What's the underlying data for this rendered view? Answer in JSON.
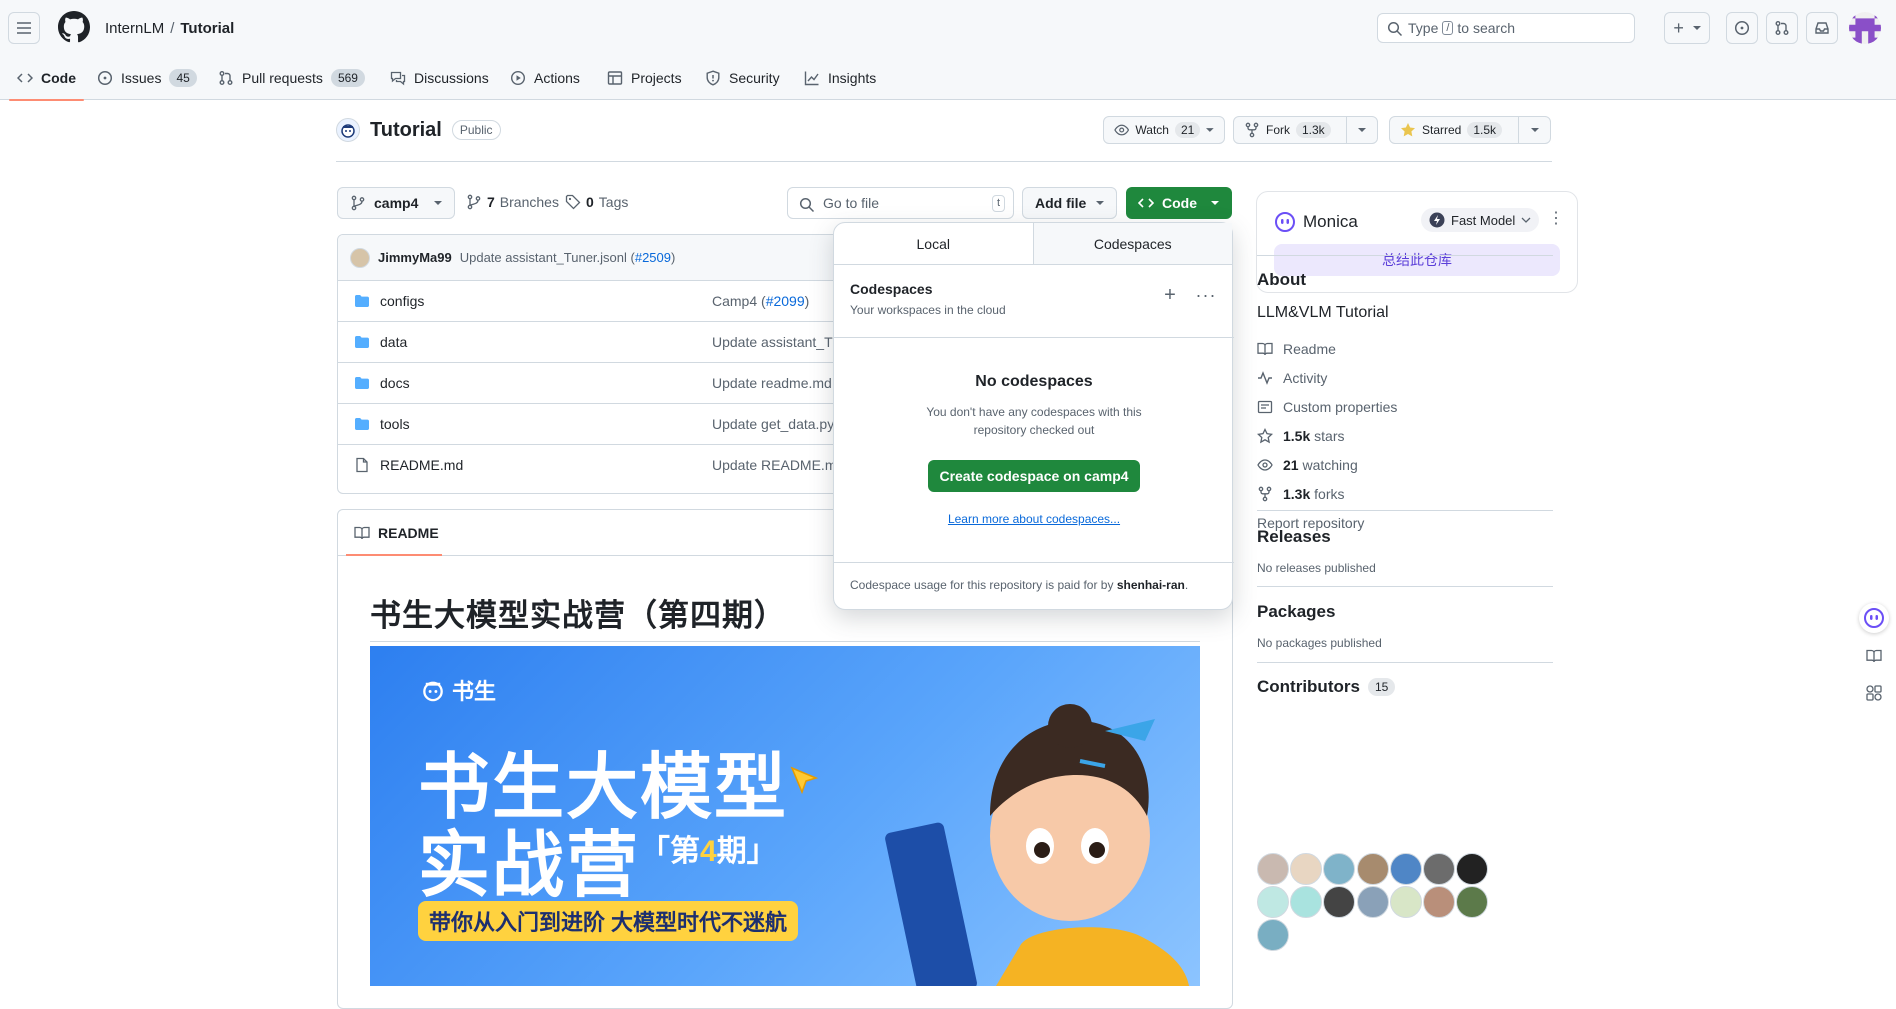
{
  "header": {
    "owner": "InternLM",
    "separator": "/",
    "repo": "Tutorial",
    "search_prefix": "Type",
    "search_key": "/",
    "search_suffix": "to search"
  },
  "nav": {
    "code": "Code",
    "issues": "Issues",
    "issues_count": "45",
    "pulls": "Pull requests",
    "pulls_count": "569",
    "discussions": "Discussions",
    "actions": "Actions",
    "projects": "Projects",
    "security": "Security",
    "insights": "Insights"
  },
  "repo": {
    "name": "Tutorial",
    "visibility": "Public",
    "watch_label": "Watch",
    "watch_count": "21",
    "fork_label": "Fork",
    "fork_count": "1.3k",
    "star_label": "Starred",
    "star_count": "1.5k"
  },
  "toolbar": {
    "branch": "camp4",
    "branches_count": "7",
    "branches_label": "Branches",
    "tags_count": "0",
    "tags_label": "Tags",
    "goto_placeholder": "Go to file",
    "goto_key": "t",
    "add_file": "Add file",
    "code_button": "Code"
  },
  "commit": {
    "author": "JimmyMa99",
    "message": "Update assistant_Tuner.jsonl (",
    "pr": "#2509",
    "close": ")"
  },
  "files": [
    {
      "name": "configs",
      "type": "folder",
      "msg": "Camp4 (",
      "pr": "#2099",
      "close": ")"
    },
    {
      "name": "data",
      "type": "folder",
      "msg": "Update assistant_Tu",
      "pr": "",
      "close": ""
    },
    {
      "name": "docs",
      "type": "folder",
      "msg": "Update readme.md",
      "pr": "",
      "close": ""
    },
    {
      "name": "tools",
      "type": "folder",
      "msg": "Update get_data.py",
      "pr": "",
      "close": ""
    },
    {
      "name": "README.md",
      "type": "file",
      "msg": "Update README.md",
      "pr": "",
      "close": ""
    }
  ],
  "readme": {
    "tab": "README",
    "heading": "书生大模型实战营（第四期）",
    "banner_brand": "书生",
    "banner_line1": "书生大模型",
    "banner_line2": "实战营",
    "banner_phase_pre": "「第",
    "banner_phase_num": "4",
    "banner_phase_post": "期」",
    "banner_tag": "带你从入门到进阶 大模型时代不迷航"
  },
  "codespaces": {
    "tab_local": "Local",
    "tab_codespaces": "Codespaces",
    "title": "Codespaces",
    "subtitle": "Your workspaces in the cloud",
    "empty_title": "No codespaces",
    "empty_desc": "You don't have any codespaces with this repository checked out",
    "create_button": "Create codespace on camp4",
    "learn_more": "Learn more about codespaces...",
    "footer_pre": "Codespace usage for this repository is paid for by",
    "footer_user": "shenhai-ran",
    "footer_post": "."
  },
  "monica": {
    "name": "Monica",
    "model": "Fast Model",
    "summarize": "总结此仓库"
  },
  "about": {
    "title": "About",
    "description": "LLM&VLM Tutorial",
    "readme": "Readme",
    "activity": "Activity",
    "custom_properties": "Custom properties",
    "stars_num": "1.5k",
    "stars_label": "stars",
    "watching_num": "21",
    "watching_label": "watching",
    "forks_num": "1.3k",
    "forks_label": "forks",
    "report": "Report repository"
  },
  "releases": {
    "title": "Releases",
    "note": "No releases published"
  },
  "packages": {
    "title": "Packages",
    "note": "No packages published"
  },
  "contributors": {
    "title": "Contributors",
    "count": "15"
  },
  "colors": {
    "accent_green": "#1f883d",
    "tab_underline": "#fd8c73",
    "link": "#0969da"
  }
}
